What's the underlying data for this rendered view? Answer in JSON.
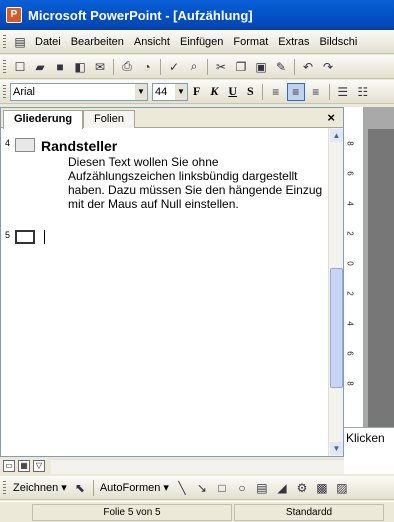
{
  "window": {
    "title": "Microsoft PowerPoint - [Aufzählung]"
  },
  "menubar": {
    "items": [
      "Datei",
      "Bearbeiten",
      "Ansicht",
      "Einfügen",
      "Format",
      "Extras",
      "Bildschi"
    ]
  },
  "format_toolbar": {
    "font_name": "Arial",
    "font_size": "44",
    "bold": "F",
    "italic": "K",
    "underline": "U",
    "shadow": "S"
  },
  "outline_pane": {
    "tabs": [
      "Gliederung",
      "Folien"
    ],
    "close": "×",
    "slides": [
      {
        "number": "4",
        "title": "Randsteller",
        "body": "Diesen Text wollen Sie ohne Aufzählungszeichen linksbündig dargestellt haben. Dazu müssen Sie den hängende Einzug mit der Maus auf Null einstellen."
      },
      {
        "number": "5",
        "title": ""
      }
    ]
  },
  "ruler": {
    "labels": [
      "8",
      "6",
      "4",
      "2",
      "0",
      "2",
      "4",
      "6",
      "8"
    ]
  },
  "notes": {
    "placeholder": "Klicken"
  },
  "drawing_toolbar": {
    "draw_label": "Zeichnen ▾",
    "autoshapes_label": "AutoFormen ▾"
  },
  "statusbar": {
    "slide_info": "Folie 5 von 5",
    "design": "Standardd"
  },
  "icons": {
    "toolbar1": [
      "new-icon",
      "open-icon",
      "save-icon",
      "permission-icon",
      "email-icon",
      "print-icon",
      "print-preview-icon",
      "spelling-icon",
      "research-icon",
      "cut-icon",
      "copy-icon",
      "paste-icon",
      "format-painter-icon",
      "undo-icon",
      "redo-icon"
    ]
  }
}
